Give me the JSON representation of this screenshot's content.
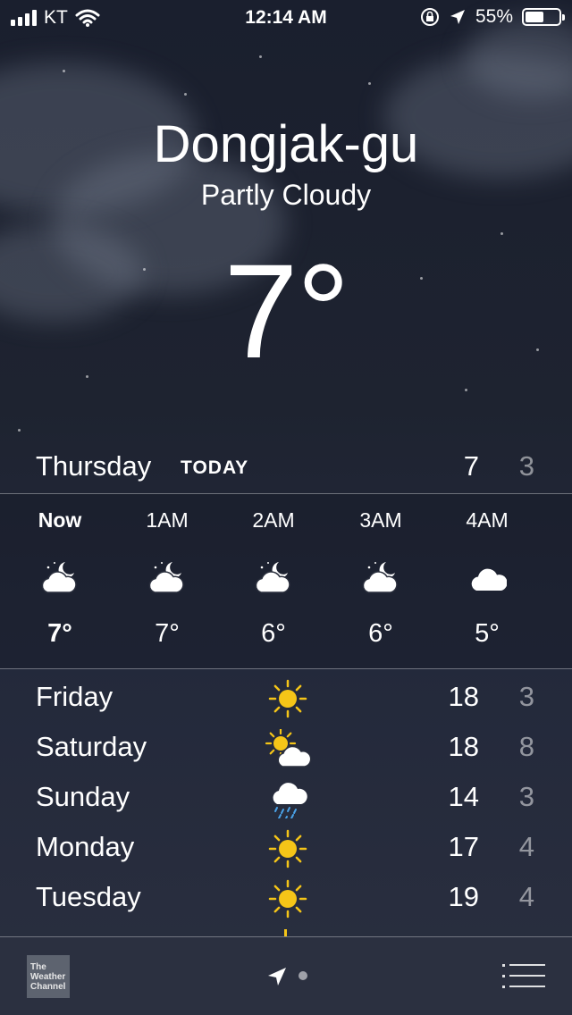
{
  "status_bar": {
    "carrier": "KT",
    "time": "12:14 AM",
    "battery_text": "55%",
    "battery_level": 0.55
  },
  "location": {
    "city": "Dongjak-gu",
    "condition": "Partly Cloudy",
    "temperature": "7°"
  },
  "today": {
    "day": "Thursday",
    "tag": "TODAY",
    "high": "7",
    "low": "3"
  },
  "hourly": [
    {
      "label": "Now",
      "icon": "partly-cloudy-night-icon",
      "temp": "7°"
    },
    {
      "label": "1AM",
      "icon": "partly-cloudy-night-icon",
      "temp": "7°"
    },
    {
      "label": "2AM",
      "icon": "partly-cloudy-night-icon",
      "temp": "6°"
    },
    {
      "label": "3AM",
      "icon": "partly-cloudy-night-icon",
      "temp": "6°"
    },
    {
      "label": "4AM",
      "icon": "cloud-icon",
      "temp": "5°"
    }
  ],
  "daily": [
    {
      "day": "Friday",
      "icon": "sun-icon",
      "high": "18",
      "low": "3"
    },
    {
      "day": "Saturday",
      "icon": "partly-sunny-icon",
      "high": "18",
      "low": "8"
    },
    {
      "day": "Sunday",
      "icon": "rain-icon",
      "high": "14",
      "low": "3"
    },
    {
      "day": "Monday",
      "icon": "sun-icon",
      "high": "17",
      "low": "4"
    },
    {
      "day": "Tuesday",
      "icon": "sun-icon",
      "high": "19",
      "low": "4"
    }
  ],
  "toolbar": {
    "brand_line1": "The",
    "brand_line2": "Weather",
    "brand_line3": "Channel"
  },
  "colors": {
    "sun": "#f5c518",
    "rain": "#4aa3e8",
    "toolbar": "#2b3040"
  }
}
